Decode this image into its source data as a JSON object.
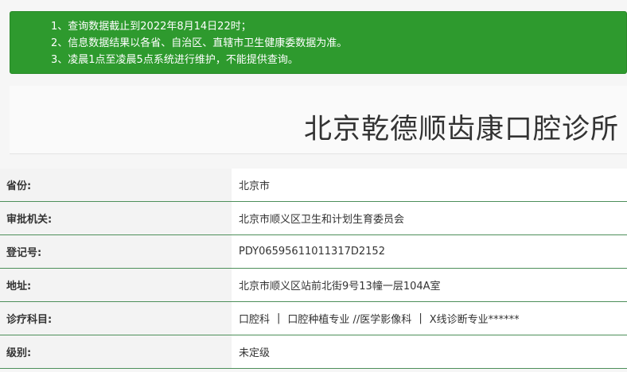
{
  "notice": {
    "lines": [
      "1、查询数据截止到2022年8月14日22时；",
      "2、信息数据结果以各省、自治区、直辖市卫生健康委数据为准。",
      "3、凌晨1点至凌晨5点系统进行维护，不能提供查询。"
    ]
  },
  "title": "北京乾德顺齿康口腔诊所",
  "rows": [
    {
      "label": "省份:",
      "value": "北京市"
    },
    {
      "label": "审批机关:",
      "value": "北京市顺义区卫生和计划生育委员会"
    },
    {
      "label": "登记号:",
      "value": "PDY06595611011317D2152"
    },
    {
      "label": "地址:",
      "value": "北京市顺义区站前北街9号13幢一层104A室"
    },
    {
      "label": "诊疗科目:",
      "items": [
        "口腔科",
        "口腔种植专业 //医学影像科",
        "X线诊断专业******"
      ],
      "separator": "|"
    },
    {
      "label": "级别:",
      "value": "未定级"
    }
  ],
  "colors": {
    "notice_bg": "#2e9a2e",
    "row_border": "#4d8f5a"
  }
}
